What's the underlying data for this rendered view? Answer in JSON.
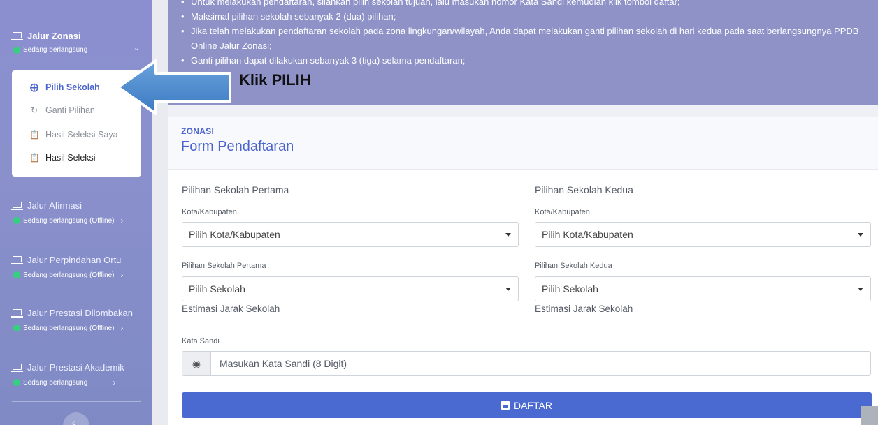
{
  "sidebar": {
    "groups": [
      {
        "title": "Jalur Zonasi",
        "status": "Sedang berlangsung"
      },
      {
        "title": "Jalur Afirmasi",
        "status": "Sedang berlangsung (Offline)"
      },
      {
        "title": "Jalur Perpindahan Ortu",
        "status": "Sedang berlangsung (Offline)"
      },
      {
        "title": "Jalur Prestasi Dilombakan",
        "status": "Sedang berlangsung (Offline)"
      },
      {
        "title": "Jalur Prestasi Akademik",
        "status": "Sedang berlangsung"
      }
    ],
    "submenu": [
      {
        "label": "Pilih Sekolah",
        "icon": "crosshair-icon"
      },
      {
        "label": "Ganti Pilihan",
        "icon": "refresh-icon"
      },
      {
        "label": "Hasil Seleksi Saya",
        "icon": "clipboard-icon"
      },
      {
        "label": "Hasil Seleksi",
        "icon": "clipboard-icon"
      }
    ]
  },
  "banner": {
    "rules": [
      "Untuk melakukan pendaftaran, silahkan pilih sekolah tujuan, lalu masukan nomor Kata Sandi kemudian klik tombol daftar;",
      "Maksimal pilihan sekolah sebanyak 2 (dua) pilihan;",
      "Jika telah melakukan pendaftaran sekolah pada zona lingkungan/wilayah, Anda dapat melakukan ganti pilihan sekolah di hari kedua pada saat berlangsungnya PPDB Online Jalur Zonasi;",
      "Ganti pilihan dapat dilakukan sebanyak 3 (tiga) selama pendaftaran;"
    ]
  },
  "annotation": {
    "callout": "Klik PILIH"
  },
  "form": {
    "section": "ZONASI",
    "title": "Form Pendaftaran",
    "first": {
      "heading": "Pilihan Sekolah Pertama",
      "city_label": "Kota/Kabupaten",
      "city_value": "Pilih Kota/Kabupaten",
      "school_label": "Pilihan Sekolah Pertama",
      "school_value": "Pilih Sekolah",
      "distance_label": "Estimasi Jarak Sekolah"
    },
    "second": {
      "heading": "Pilihan Sekolah Kedua",
      "city_label": "Kota/Kabupaten",
      "city_value": "Pilih Kota/Kabupaten",
      "school_label": "Pilihan Sekolah Kedua",
      "school_value": "Pilih Sekolah",
      "distance_label": "Estimasi Jarak Sekolah"
    },
    "password_label": "Kata Sandi",
    "password_placeholder": "Masukan Kata Sandi (8 Digit)",
    "submit_label": "DAFTAR"
  },
  "colors": {
    "accent": "#4a63cf",
    "sidebar": "#8b8fd0",
    "status_dot": "#35d07f",
    "button": "#4a6ad2"
  }
}
